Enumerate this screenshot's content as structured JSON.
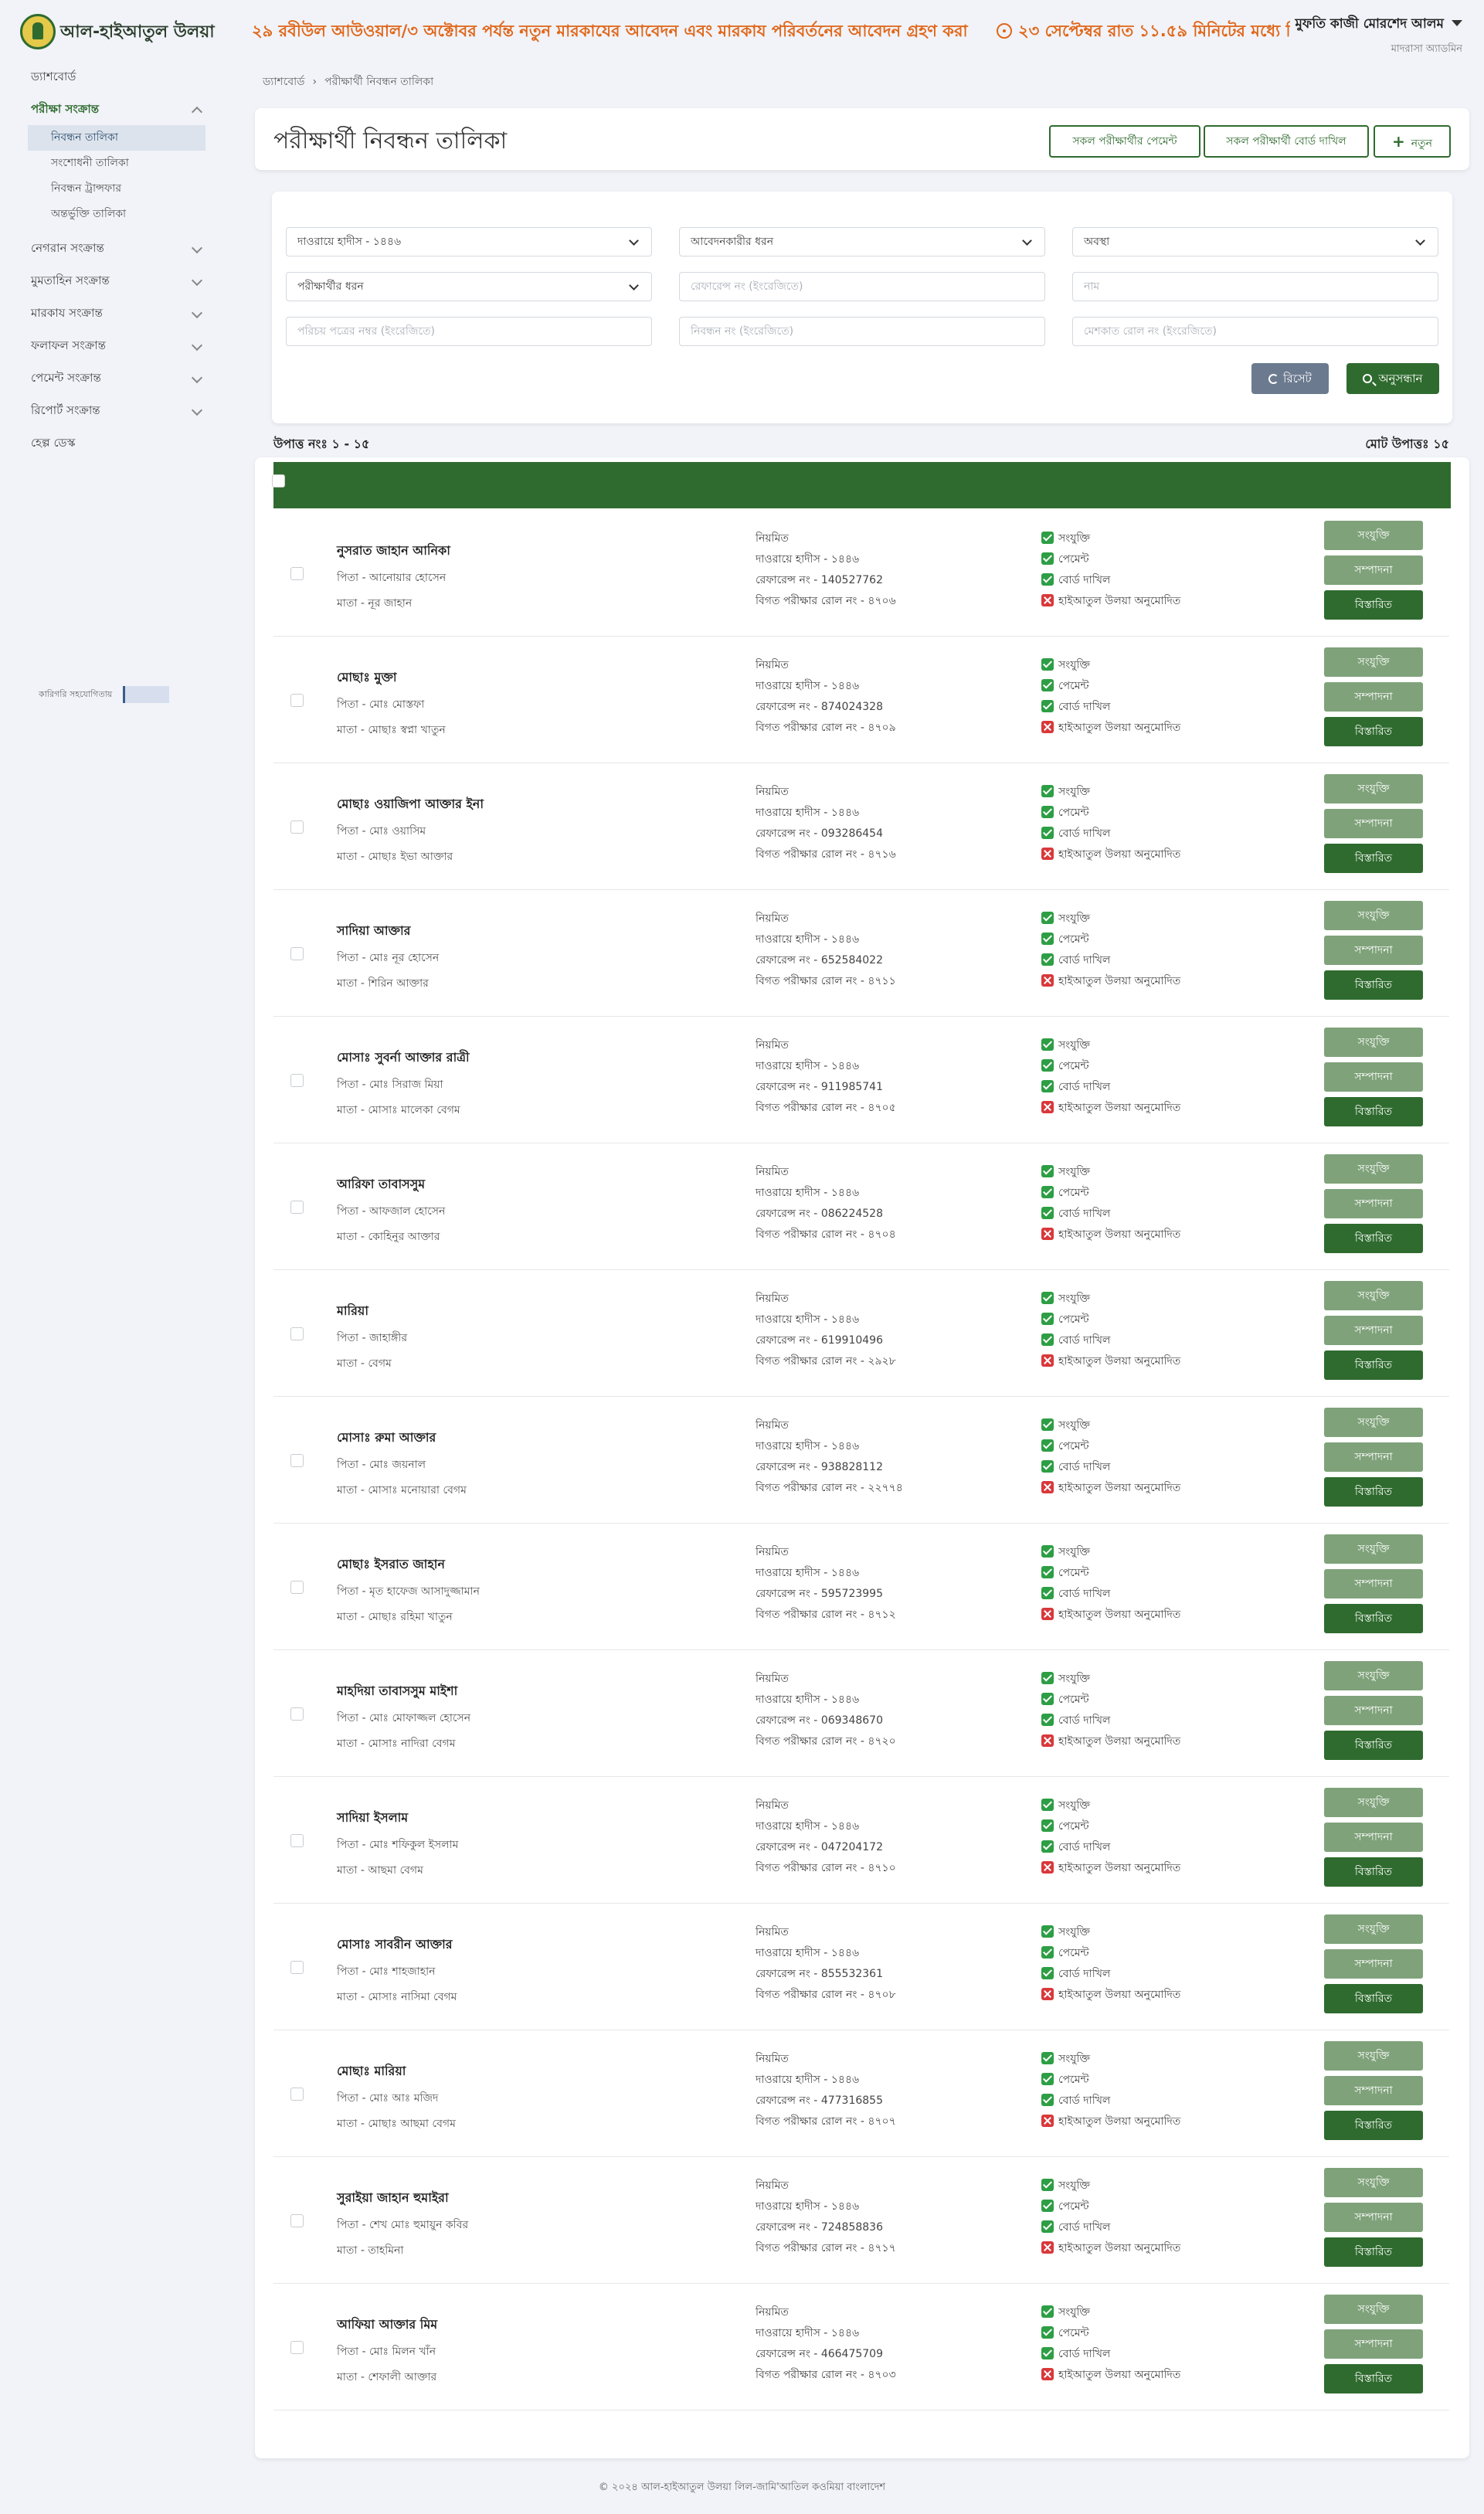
{
  "header": {
    "brand": "আল-হাইআতুল উলয়া",
    "notice": "২৯ রবীউল আউওয়াল/৩ অক্টোবর পর্যন্ত নতুন মারকাযের আবেদন এবং মারকায পরিবর্তনের আবেদন গ্রহণ করা হবে।",
    "notice2": "২৩ সেপ্টেম্বর রাত ১১.৫৯ মিনিটের মধ্যে নিব",
    "user_name": "মুফতি কাজী মোরশেদ আলম",
    "user_role": "মাদরাসা অ্যাডমিন"
  },
  "sidebar": {
    "dashboard": "ড্যাশবোর্ড",
    "exam_group": "পরীক্ষা সংক্রান্ত",
    "sub_items": [
      "নিবন্ধন তালিকা",
      "সংশোধনী তালিকা",
      "নিবন্ধন ট্রান্সফার",
      "অন্তর্ভুক্তি তালিকা"
    ],
    "menus": [
      "নেগরান সংক্রান্ত",
      "মুমতাহিন সংক্রান্ত",
      "মারকায সংক্রান্ত",
      "ফলাফল সংক্রান্ত",
      "পেমেন্ট সংক্রান্ত",
      "রিপোর্ট সংক্রান্ত"
    ],
    "help": "হেল্প ডেস্ক",
    "tech": "কারিগরি সহযোগিতায়"
  },
  "breadcrumb": {
    "home": "ড্যাশবোর্ড",
    "current": "পরীক্ষার্থী নিবন্ধন তালিকা"
  },
  "page": {
    "title": "পরীক্ষার্থী নিবন্ধন তালিকা",
    "btn_payment": "সকল পরীক্ষার্থীর পেমেন্ট",
    "btn_board": "সকল পরীক্ষার্থী বোর্ড দাখিল",
    "btn_new": "নতুন"
  },
  "filters": {
    "marhala": "দাওরায়ে হাদীস - ১৪৪৬",
    "applicant_type": "আবেদনকারীর ধরন",
    "status": "অবস্থা",
    "examinee_type": "পরীক্ষার্থীর ধরন",
    "reference_placeholder": "রেফারেন্স নং (ইংরেজিতে)",
    "name_placeholder": "নাম",
    "id_placeholder": "পরিচয় পত্রের নম্বর (ইংরেজিতে)",
    "reg_placeholder": "নিবন্ধন নং (ইংরেজিতে)",
    "roll_placeholder": "মেশকাত রোল নং (ইংরেজিতে)",
    "btn_reset": "রিসেট",
    "btn_search": "অনুসন্ধান"
  },
  "counts": {
    "range": "উপাত্ত নংঃ ১ - ১৫",
    "total": "মোট উপাত্তঃ ১৫"
  },
  "row_labels": {
    "regular": "নিয়মিত",
    "marhala": "দাওরায়ে হাদীস - ১৪৪৬",
    "ref_prefix": "রেফারেন্স নং - ",
    "roll_prefix": "বিগত পরীক্ষার রোল নং - ",
    "s1": "সংযুক্তি",
    "s2": "পেমেন্ট",
    "s3": "বোর্ড দাখিল",
    "s4": "হাইআতুল উলয়া অনুমোদিত",
    "a1": "সংযুক্তি",
    "a2": "সম্পাদনা",
    "a3": "বিস্তারিত"
  },
  "rows": [
    {
      "name": "নুসরাত জাহান আনিকা",
      "father": "পিতা - আনোয়ার হোসেন",
      "mother": "মাতা - নূর জাহান",
      "ref": "140527762",
      "roll": "৪৭০৬"
    },
    {
      "name": "মোছাঃ মুক্তা",
      "father": "পিতা - মোঃ মোস্তফা",
      "mother": "মাতা - মোছাঃ স্বপ্না খাতুন",
      "ref": "874024328",
      "roll": "৪৭০৯"
    },
    {
      "name": "মোছাঃ ওয়াজিপা আক্তার ইনা",
      "father": "পিতা - মোঃ ওয়াসিম",
      "mother": "মাতা - মোছাঃ ইভা আক্তার",
      "ref": "093286454",
      "roll": "৪৭১৬"
    },
    {
      "name": "সাদিয়া আক্তার",
      "father": "পিতা - মোঃ নূর হোসেন",
      "mother": "মাতা - শিরিন আক্তার",
      "ref": "652584022",
      "roll": "৪৭১১"
    },
    {
      "name": "মোসাঃ সুবর্না আক্তার রাত্রী",
      "father": "পিতা - মোঃ সিরাজ মিয়া",
      "mother": "মাতা - মোসাঃ মালেকা বেগম",
      "ref": "911985741",
      "roll": "৪৭০৫"
    },
    {
      "name": "আরিফা তাবাসসুম",
      "father": "পিতা - আফজাল হোসেন",
      "mother": "মাতা - কোহিনুর আক্তার",
      "ref": "086224528",
      "roll": "৪৭০৪"
    },
    {
      "name": "মারিয়া",
      "father": "পিতা - জাহাঙ্গীর",
      "mother": "মাতা - বেগম",
      "ref": "619910496",
      "roll": "২৯২৮"
    },
    {
      "name": "মোসাঃ রুমা আক্তার",
      "father": "পিতা - মোঃ জয়নাল",
      "mother": "মাতা - মোসাঃ মনোয়ারা বেগম",
      "ref": "938828112",
      "roll": "২২৭৭৪"
    },
    {
      "name": "মোছাঃ ইসরাত জাহান",
      "father": "পিতা - মৃত হাফেজ আসাদুজ্জামান",
      "mother": "মাতা - মোছাঃ রহিমা খাতুন",
      "ref": "595723995",
      "roll": "৪৭১২"
    },
    {
      "name": "মাহদিয়া তাবাসসুম মাইশা",
      "father": "পিতা - মোঃ মোফাজ্জল হোসেন",
      "mother": "মাতা - মোসাঃ নাদিরা বেগম",
      "ref": "069348670",
      "roll": "৪৭২০"
    },
    {
      "name": "সাদিয়া ইসলাম",
      "father": "পিতা - মোঃ শফিকুল ইসলাম",
      "mother": "মাতা - আছমা বেগম",
      "ref": "047204172",
      "roll": "৪৭১০"
    },
    {
      "name": "মোসাঃ সাবরীন আক্তার",
      "father": "পিতা - মোঃ শাহজাহান",
      "mother": "মাতা - মোসাঃ নাসিমা বেগম",
      "ref": "855532361",
      "roll": "৪৭০৮"
    },
    {
      "name": "মোছাঃ মারিয়া",
      "father": "পিতা - মোঃ আঃ মজিদ",
      "mother": "মাতা - মোছাঃ আছমা বেগম",
      "ref": "477316855",
      "roll": "৪৭০৭"
    },
    {
      "name": "সুরাইয়া জাহান হুমাইরা",
      "father": "পিতা - শেখ মোঃ হুমায়ুন কবির",
      "mother": "মাতা - তাহমিনা",
      "ref": "724858836",
      "roll": "৪৭১৭"
    },
    {
      "name": "আফিয়া আক্তার মিম",
      "father": "পিতা - মোঃ মিলন খাঁন",
      "mother": "মাতা - শেফালী আক্তার",
      "ref": "466475709",
      "roll": "৪৭০৩"
    }
  ],
  "footer": "© ২০২৪ আল-হাইআতুল উলয়া লিল-জামি'আতিল কওমিয়া বাংলাদেশ",
  "colors": {
    "primary": "#2f6b2f",
    "primary_light": "#7fa27a",
    "notice": "#e0671a",
    "check": "#2e9e45",
    "cross": "#d9383b"
  }
}
